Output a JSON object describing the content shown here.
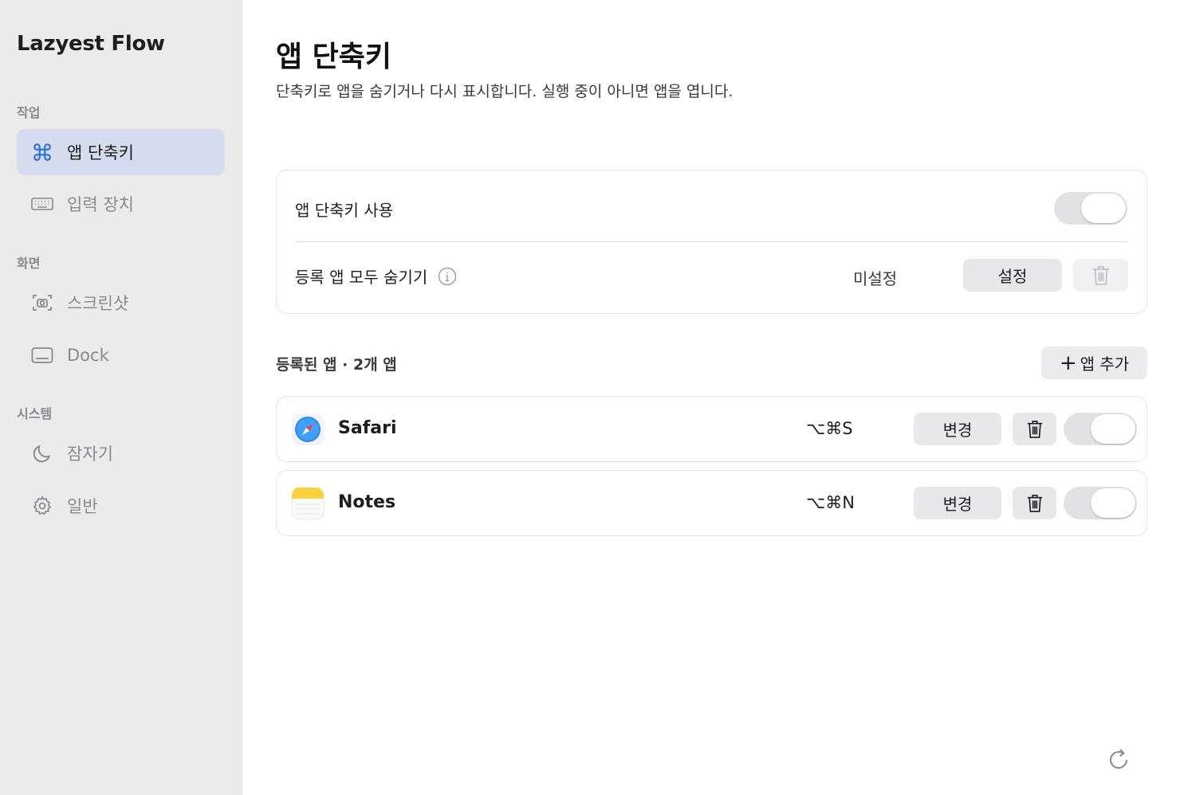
{
  "sidebar": {
    "app_title": "Lazyest Flow",
    "sections": [
      {
        "label": "작업"
      },
      {
        "label": "화면"
      },
      {
        "label": "시스템"
      }
    ],
    "items": [
      {
        "label": "앱 단축키",
        "icon": "command-icon",
        "active": true
      },
      {
        "label": "입력 장치",
        "icon": "keyboard-icon"
      },
      {
        "label": "스크린샷",
        "icon": "screenshot-icon"
      },
      {
        "label": "Dock",
        "icon": "dock-icon"
      },
      {
        "label": "잠자기",
        "icon": "moon-icon"
      },
      {
        "label": "일반",
        "icon": "gear-icon"
      }
    ]
  },
  "main": {
    "title": "앱 단축키",
    "subtitle": "단축키로 앱을 숨기거나 다시 표시합니다. 실행 중이 아니면 앱을 엽니다.",
    "settings": {
      "enable_label": "앱 단축키 사용",
      "enable_on": false,
      "hide_all_label": "등록 앱 모두 숨기기",
      "hide_all_value": "미설정",
      "set_button": "설정"
    },
    "registered": {
      "header": "등록된 앱 · 2개 앱",
      "add_button": "앱 추가",
      "apps": [
        {
          "name": "Safari",
          "shortcut": "⌥⌘S",
          "change_button": "변경",
          "icon": "safari-icon",
          "enabled": false
        },
        {
          "name": "Notes",
          "shortcut": "⌥⌘N",
          "change_button": "변경",
          "icon": "notes-icon",
          "enabled": false
        }
      ]
    }
  },
  "colors": {
    "accent": "#2f6fe0",
    "sidebar_bg": "#ebebeb",
    "active_item_bg": "#d5dced"
  }
}
